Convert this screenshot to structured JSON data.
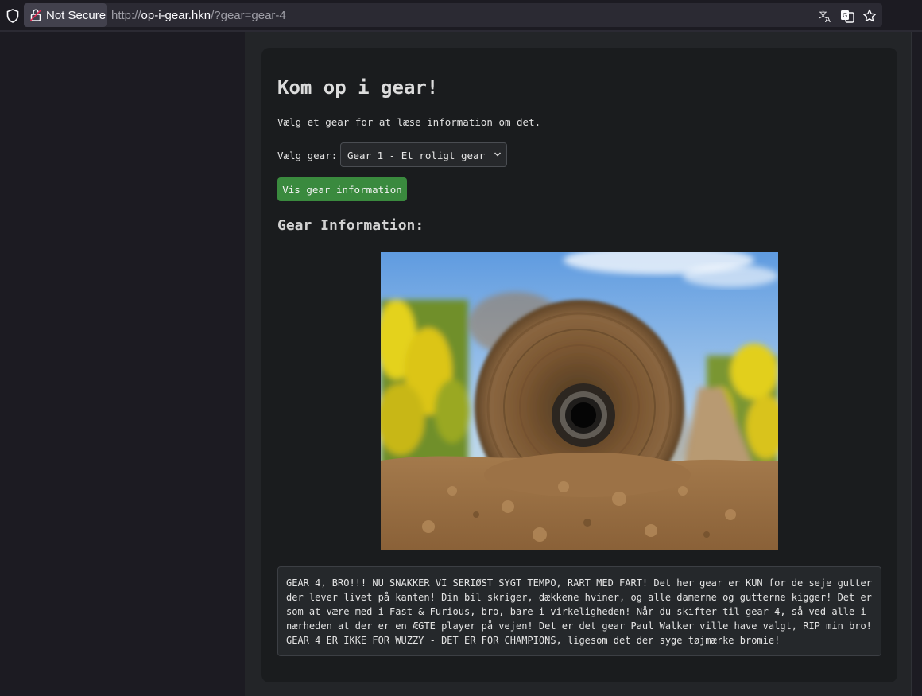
{
  "browser": {
    "security_label": "Not Secure",
    "url_prefix": "http://",
    "url_host": "op-i-gear.hkn",
    "url_path": "/?gear=gear-4"
  },
  "page": {
    "title": "Kom op i gear!",
    "subtitle": "Vælg et gear for at læse information om det.",
    "select_label": "Vælg gear:",
    "select_value": "Gear 1 - Et roligt gear",
    "button_label": "Vis gear information",
    "section_title": "Gear Information:",
    "info_text": "GEAR 4, BRO!!! NU SNAKKER VI SERIØST SYGT TEMPO, RART MED FART! Det her gear er KUN for de seje gutter\nder lever livet på kanten! Din bil skriger, dækkene hviner, og alle damerne og gutterne kigger! Det er\nsom at være med i Fast & Furious, bro, bare i virkeligheden! Når du skifter til gear 4, så ved alle i\nnærheden at der er en ÆGTE player på vejen! Det er det gear Paul Walker ville have valgt, RIP min bro!\nGEAR 4 ER IKKE FOR WUZZY - DET ER FOR CHAMPIONS, ligesom det der syge tøjmærke bromie!"
  },
  "colors": {
    "button_green": "#3a8a3e",
    "card_bg": "#1a1c1e"
  }
}
